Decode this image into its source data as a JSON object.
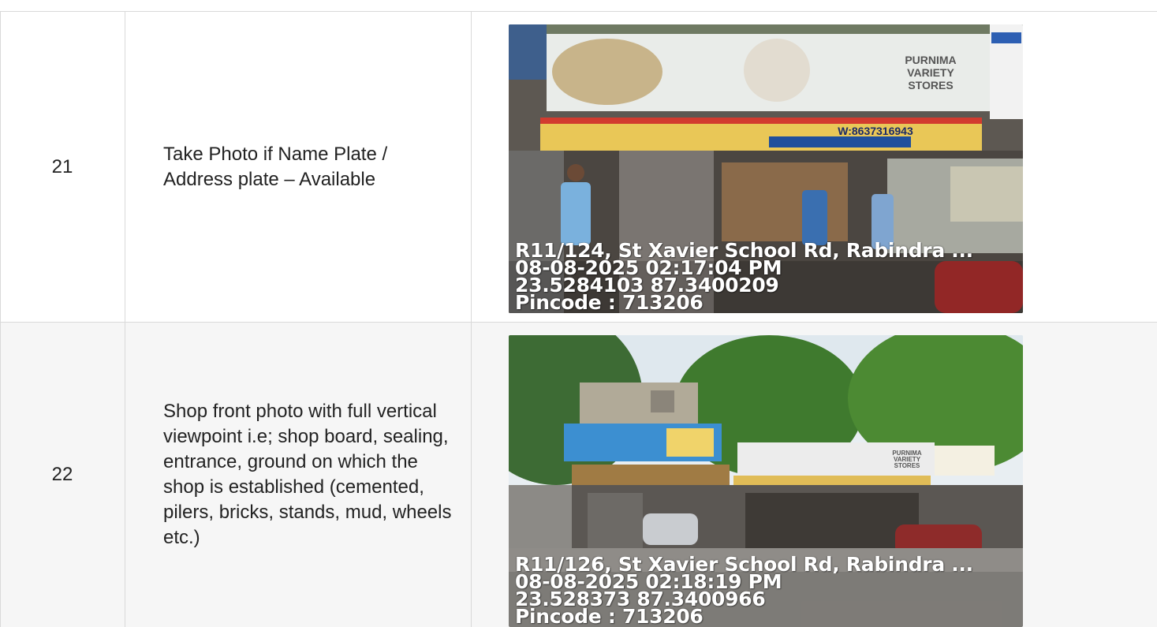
{
  "rows": [
    {
      "number": "21",
      "description": "Take Photo if Name Plate / Address plate – Available",
      "photo": {
        "address": "R11/124, St Xavier School Rd, Rabindra ...",
        "datetime": "08-08-2025 02:17:04 PM",
        "coordinates": "23.5284103 87.3400209",
        "pincode": "Pincode : 713206",
        "sign_text": "PURNIMA VARIETY STORES",
        "phone_text": "W:8637316943"
      }
    },
    {
      "number": "22",
      "description": "Shop front photo with full vertical viewpoint i.e; shop board, sealing, entrance, ground on which the shop is established (cemented, pilers, bricks, stands, mud, wheels etc.)",
      "photo": {
        "address": "R11/126, St Xavier School Rd, Rabindra ...",
        "datetime": "08-08-2025 02:18:19 PM",
        "coordinates": "23.528373 87.3400966",
        "pincode": "Pincode : 713206",
        "sign_text": "PURNIMA VARIETY STORES"
      }
    }
  ]
}
